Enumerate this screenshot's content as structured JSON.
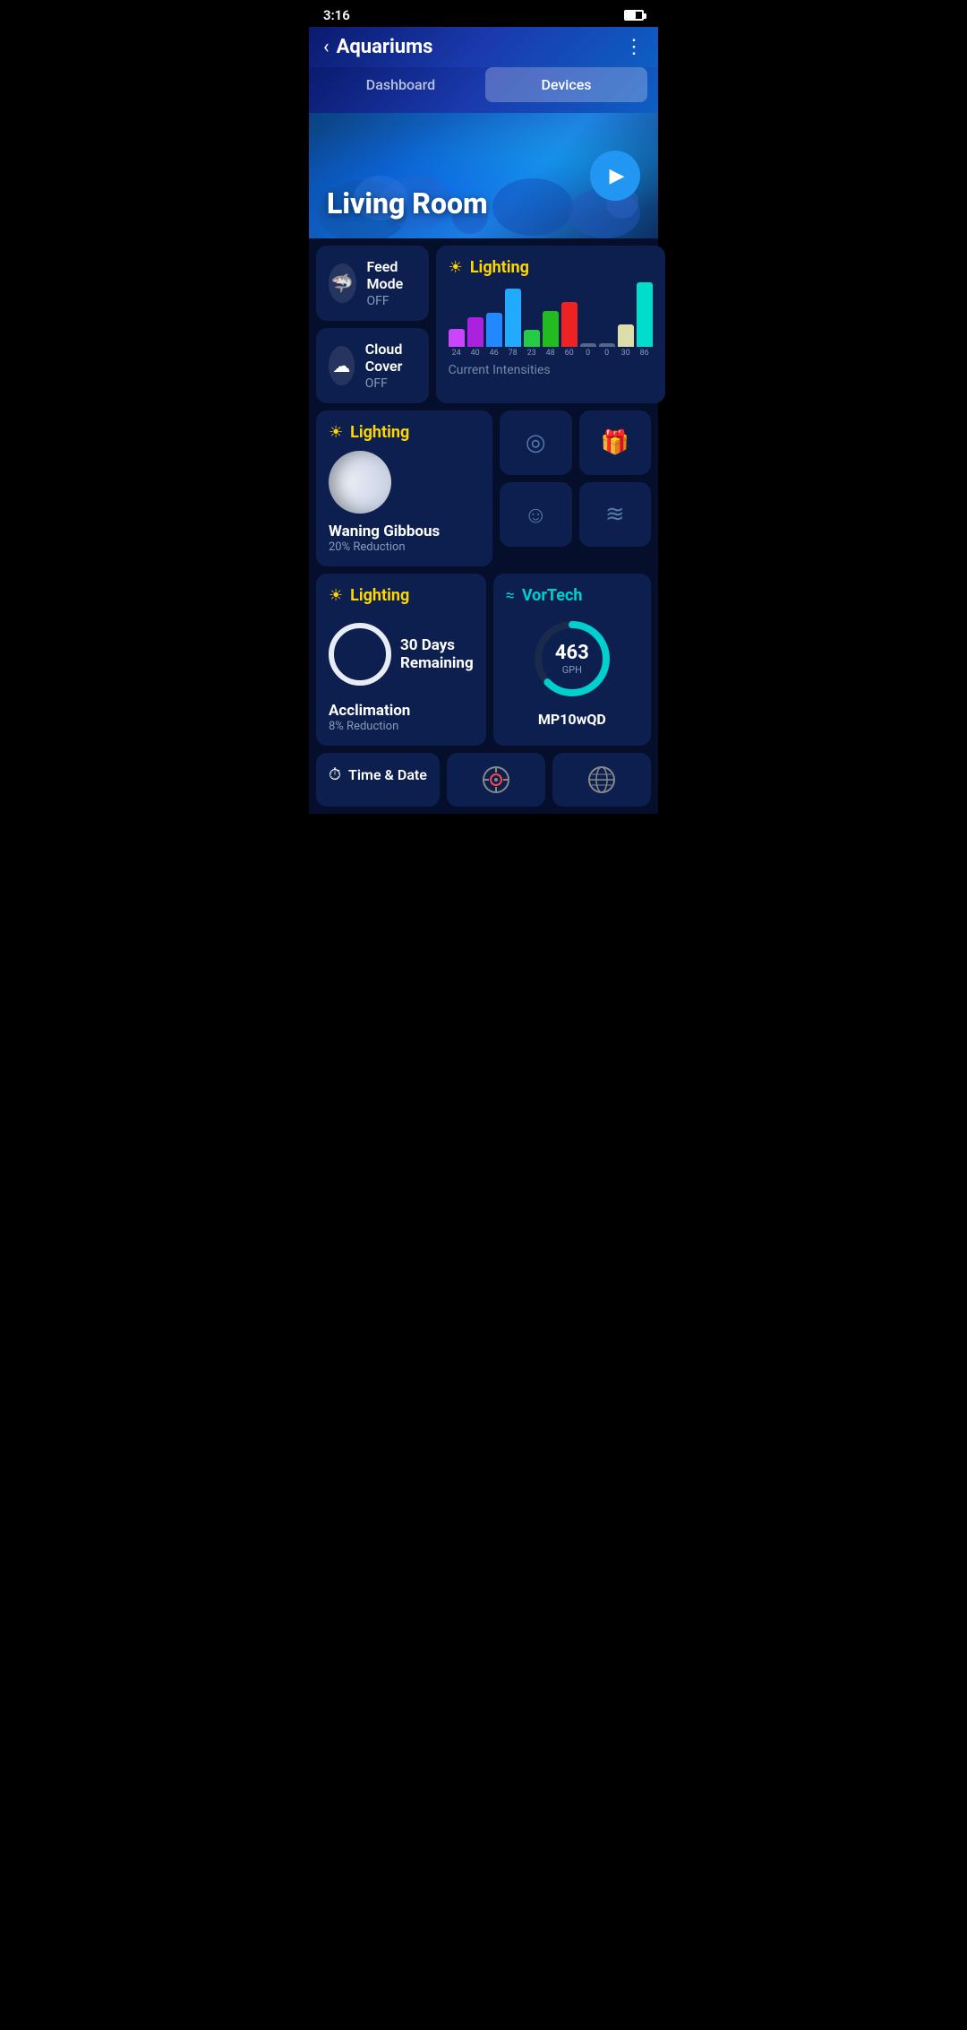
{
  "statusBar": {
    "time": "3:16"
  },
  "header": {
    "title": "Aquariums",
    "backLabel": "‹",
    "moreLabel": "⋮"
  },
  "tabs": [
    {
      "id": "dashboard",
      "label": "Dashboard",
      "active": false
    },
    {
      "id": "devices",
      "label": "Devices",
      "active": true
    }
  ],
  "banner": {
    "title": "Living Room",
    "playAriaLabel": "Play"
  },
  "feedMode": {
    "label": "Feed Mode",
    "value": "OFF"
  },
  "cloudCover": {
    "label": "Cloud Cover",
    "value": "OFF"
  },
  "lightingChart": {
    "title": "Lighting",
    "subtitle": "Current Intensities",
    "bars": [
      {
        "value": 24,
        "color": "#CC44FF",
        "label": "24"
      },
      {
        "value": 40,
        "color": "#AA22DD",
        "label": "40"
      },
      {
        "value": 46,
        "color": "#2288FF",
        "label": "46"
      },
      {
        "value": 78,
        "color": "#22AAFF",
        "label": "78"
      },
      {
        "value": 23,
        "color": "#22CC44",
        "label": "23"
      },
      {
        "value": 48,
        "color": "#22BB22",
        "label": "48"
      },
      {
        "value": 60,
        "color": "#EE2222",
        "label": "60"
      },
      {
        "value": 0,
        "color": "#556688",
        "label": "0"
      },
      {
        "value": 0,
        "color": "#556688",
        "label": "0"
      },
      {
        "value": 30,
        "color": "#DDDDAA",
        "label": "30"
      },
      {
        "value": 86,
        "color": "#00DDCC",
        "label": "86"
      }
    ]
  },
  "lightingMoon": {
    "title": "Lighting",
    "moonPhase": "Waning Gibbous",
    "reductionLabel": "20% Reduction"
  },
  "actionButtons": [
    {
      "id": "target",
      "icon": "⊙"
    },
    {
      "id": "gift",
      "icon": "🎁"
    },
    {
      "id": "smiley",
      "icon": "☺"
    },
    {
      "id": "wind",
      "icon": "💨"
    }
  ],
  "lightingAcclimation": {
    "title": "Lighting",
    "daysRemaining": "30 Days",
    "daysLabel": "Remaining",
    "phase": "Acclimation",
    "reduction": "8% Reduction"
  },
  "vortech": {
    "title": "VorTech",
    "value": "463",
    "unit": "GPH",
    "model": "MP10wQD",
    "gaugePercent": 65
  },
  "timeDate": {
    "title": "Time & Date"
  }
}
